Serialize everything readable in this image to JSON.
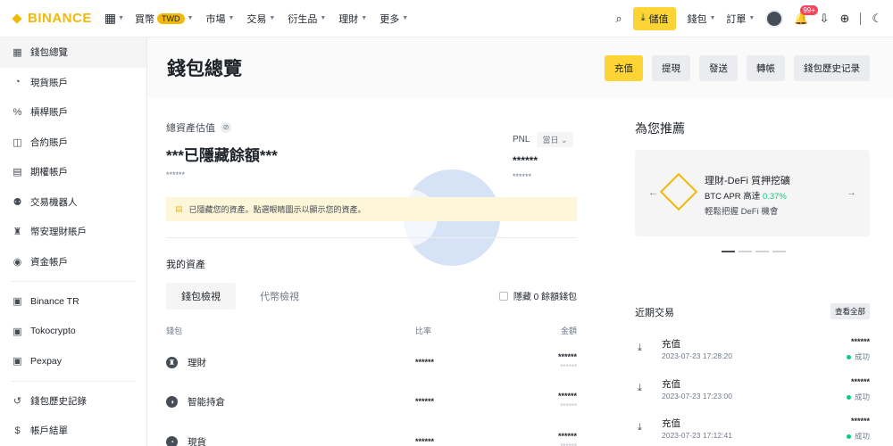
{
  "topbar": {
    "logo": "BINANCE",
    "nav": [
      {
        "label": "買幣"
      },
      {
        "label": "市場"
      },
      {
        "label": "交易"
      },
      {
        "label": "衍生品"
      },
      {
        "label": "理財"
      },
      {
        "label": "更多"
      }
    ],
    "currency_badge": "TWD",
    "deposit_label": "儲值",
    "wallet_label": "錢包",
    "orders_label": "訂單",
    "notification_count": "99+"
  },
  "sidebar": {
    "items": [
      {
        "label": "錢包總覽",
        "icon": "dashboard-icon"
      },
      {
        "label": "現貨賬戶",
        "icon": "spot-icon"
      },
      {
        "label": "槓桿賬戶",
        "icon": "percent-icon"
      },
      {
        "label": "合約賬戶",
        "icon": "futures-icon"
      },
      {
        "label": "期權帳戶",
        "icon": "options-icon"
      },
      {
        "label": "交易機器人",
        "icon": "robot-icon"
      },
      {
        "label": "幣安理財賬戶",
        "icon": "piggy-icon"
      },
      {
        "label": "資金帳戶",
        "icon": "funding-icon"
      }
    ],
    "third_party": [
      {
        "label": "Binance TR"
      },
      {
        "label": "Tokocrypto"
      },
      {
        "label": "Pexpay"
      }
    ],
    "bottom": [
      {
        "label": "錢包歷史記錄"
      },
      {
        "label": "帳戶結單"
      }
    ]
  },
  "header": {
    "title": "錢包總覽",
    "actions": [
      "充值",
      "提現",
      "發送",
      "轉帳",
      "錢包歷史记录"
    ]
  },
  "overview": {
    "estimate_label": "總資產估值",
    "hidden_balance": "***已隱藏餘額***",
    "hidden_sub": "******",
    "pnl_label": "PNL",
    "pnl_period": "當日",
    "pnl_value": "******",
    "pnl_sub": "******",
    "notice": "已隱藏您的資產。點選眼睛圖示以顯示您的資產。"
  },
  "assets": {
    "title": "我的資產",
    "tabs": [
      "錢包檢視",
      "代幣檢視"
    ],
    "hide_zero": "隱藏 0 餘額錢包",
    "columns": [
      "錢包",
      "比率",
      "金額"
    ],
    "rows": [
      {
        "name": "理財",
        "icon": "earn-icon",
        "ratio": "******",
        "amount": "******",
        "amount_sub": "******"
      },
      {
        "name": "智能持倉",
        "icon": "smart-icon",
        "ratio": "******",
        "amount": "******",
        "amount_sub": "******"
      },
      {
        "name": "現貨",
        "icon": "spot-icon",
        "ratio": "******",
        "amount": "******",
        "amount_sub": "******"
      }
    ]
  },
  "recommend": {
    "title": "為您推薦",
    "card_title": "理財-DeFi 質押挖礦",
    "card_apr_prefix": "BTC APR 高達",
    "card_apr_value": "0.37%",
    "card_sub": "輕鬆把握 DeFi 機會"
  },
  "recent": {
    "title": "近期交易",
    "view_all": "查看全部",
    "items": [
      {
        "name": "充值",
        "date": "2023-07-23 17:28:20",
        "amount": "******",
        "status": "成功"
      },
      {
        "name": "充值",
        "date": "2023-07-23 17:23:00",
        "amount": "******",
        "status": "成功"
      },
      {
        "name": "充值",
        "date": "2023-07-23 17:12:41",
        "amount": "******",
        "status": "成功"
      }
    ]
  },
  "colors": {
    "brand": "#f0b90b",
    "button": "#fcd535",
    "success": "#0ecb81"
  }
}
